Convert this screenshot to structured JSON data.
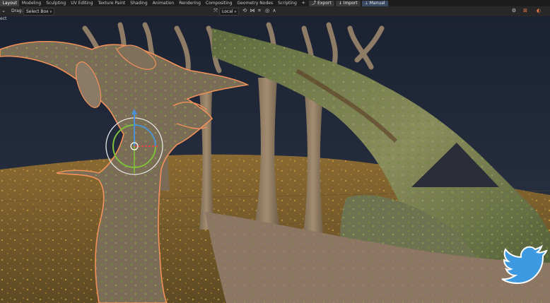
{
  "workspace_tabs": [
    {
      "label": "Layout",
      "active": true
    },
    {
      "label": "Modeling",
      "active": false
    },
    {
      "label": "Sculpting",
      "active": false
    },
    {
      "label": "UV Editing",
      "active": false
    },
    {
      "label": "Texture Paint",
      "active": false
    },
    {
      "label": "Shading",
      "active": false
    },
    {
      "label": "Animation",
      "active": false
    },
    {
      "label": "Rendering",
      "active": false
    },
    {
      "label": "Compositing",
      "active": false
    },
    {
      "label": "Geometry Nodes",
      "active": false
    },
    {
      "label": "Scripting",
      "active": false
    }
  ],
  "add_workspace": "+",
  "top_actions": {
    "export": "Export",
    "import": "Import",
    "manual": "Manual"
  },
  "header": {
    "drag_label": "Drag:",
    "drag_value": "Select Box",
    "transform_orientation": "Local"
  },
  "subheader": {
    "mode_text": "ect"
  },
  "colors": {
    "sky_top": "#1b2232",
    "sky_bottom": "#2c3546",
    "selection_outline": "#f2915a",
    "gizmo_green": "#7fbf3a",
    "gizmo_blue": "#4a8fd8",
    "gizmo_red": "#e0454a",
    "twitter_blue": "#3e9ae0"
  },
  "icons": {
    "twitter": "twitter-bird-icon",
    "triangle": "play-triangle-icon"
  }
}
